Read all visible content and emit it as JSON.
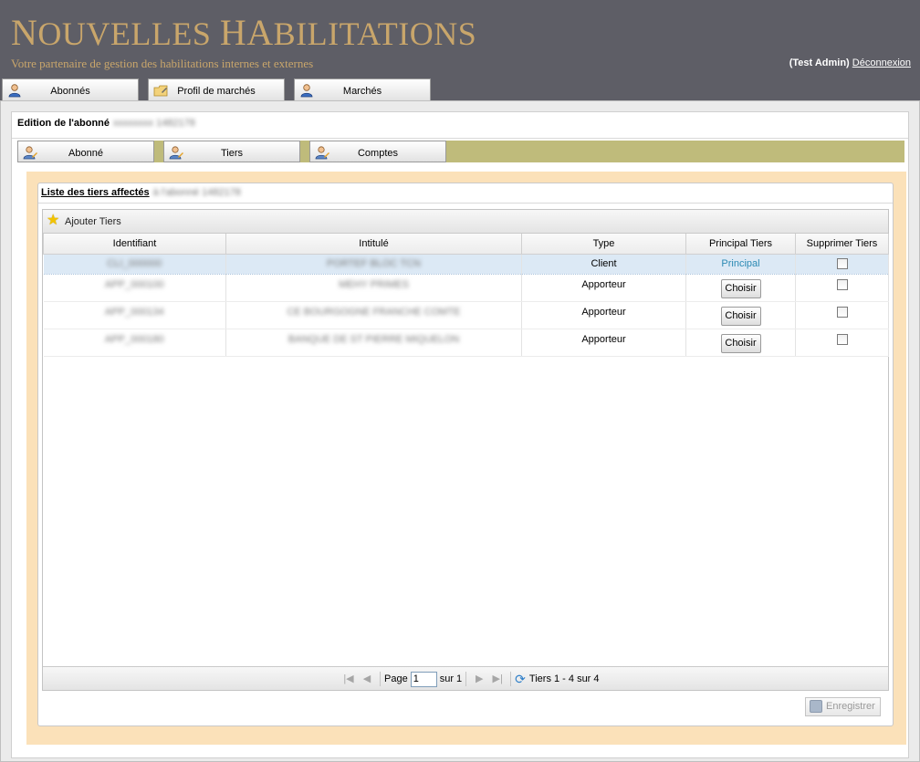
{
  "app": {
    "title_first": "N",
    "title_part1": "OUVELLES ",
    "title_second": "HA",
    "title_part2": "BILITATIONS",
    "tagline": "Votre partenaire de gestion des habilitations internes et externes"
  },
  "user": {
    "name": "(Test Admin)",
    "logout": "Déconnexion"
  },
  "main_tabs": [
    {
      "label": "Abonnés",
      "icon": "user-icon"
    },
    {
      "label": "Profil de marchés",
      "icon": "folder-edit-icon"
    },
    {
      "label": "Marchés",
      "icon": "user-icon"
    }
  ],
  "edit": {
    "title": "Edition de l'abonné",
    "subscriber_name": "xxxxxxxx 1482178"
  },
  "sub_tabs": [
    {
      "label": "Abonné",
      "icon": "user-edit-icon"
    },
    {
      "label": "Tiers",
      "icon": "user-edit-icon"
    },
    {
      "label": "Comptes",
      "icon": "user-edit-icon"
    }
  ],
  "list": {
    "title": "Liste des tiers affectés",
    "title_suffix": "à l'abonné 1482178",
    "add_label": "Ajouter Tiers",
    "columns": [
      "Identifiant",
      "Intitulé",
      "Type",
      "Principal Tiers",
      "Supprimer Tiers"
    ],
    "rows": [
      {
        "identifiant": "CLI_000000",
        "intitule": "PORTEF BLOC TCN",
        "type": "Client",
        "principal": "Principal",
        "is_principal": true
      },
      {
        "identifiant": "APP_000100",
        "intitule": "MEHY PRIMES",
        "type": "Apporteur",
        "principal": "Choisir",
        "is_principal": false
      },
      {
        "identifiant": "APP_000134",
        "intitule": "CE BOURGOGNE FRANCHE COMTE",
        "type": "Apporteur",
        "principal": "Choisir",
        "is_principal": false
      },
      {
        "identifiant": "APP_000180",
        "intitule": "BANQUE DE ST PIERRE MIQUELON",
        "type": "Apporteur",
        "principal": "Choisir",
        "is_principal": false
      }
    ]
  },
  "pager": {
    "page_label": "Page",
    "page_value": "1",
    "of_label": "sur 1",
    "summary": "Tiers 1 - 4 sur 4"
  },
  "save_label": "Enregistrer",
  "colors": {
    "header_bg": "#5e5e66",
    "brand": "#c9a66b",
    "tabbar": "#bfbb7b",
    "beige": "#fbe1b9",
    "link": "#2c8ab4"
  }
}
